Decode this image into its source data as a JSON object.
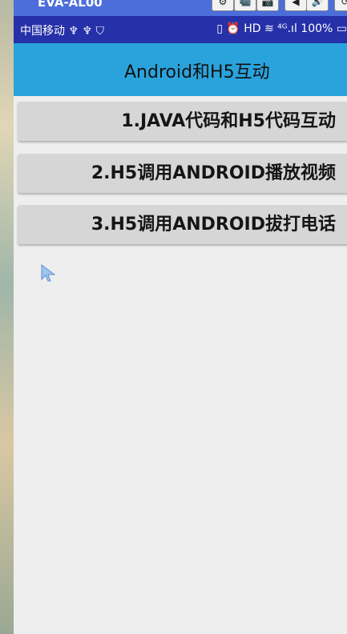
{
  "emulator": {
    "title": "EVA-AL00",
    "buttons": [
      "⚙",
      "📹",
      "📷",
      "◀",
      "🔊",
      "⟳"
    ]
  },
  "status_bar": {
    "left_text": "中国移动 ♆ ♆ ⛉",
    "right_text": "▯ ⏰ HD ≋ ⁴ᴳ.ıl 100% ▭"
  },
  "app": {
    "title": "Android和H5互动",
    "buttons": [
      {
        "label": "1.JAVA代码和H5代码互动"
      },
      {
        "label": "2.H5调用ANDROID播放视频"
      },
      {
        "label": "3.H5调用ANDROID拔打电话"
      }
    ]
  },
  "colors": {
    "status_bar": "#2630a8",
    "app_bar": "#2aa3dc",
    "button_bg": "#d6d6d6",
    "app_bg": "#eeeeee"
  }
}
